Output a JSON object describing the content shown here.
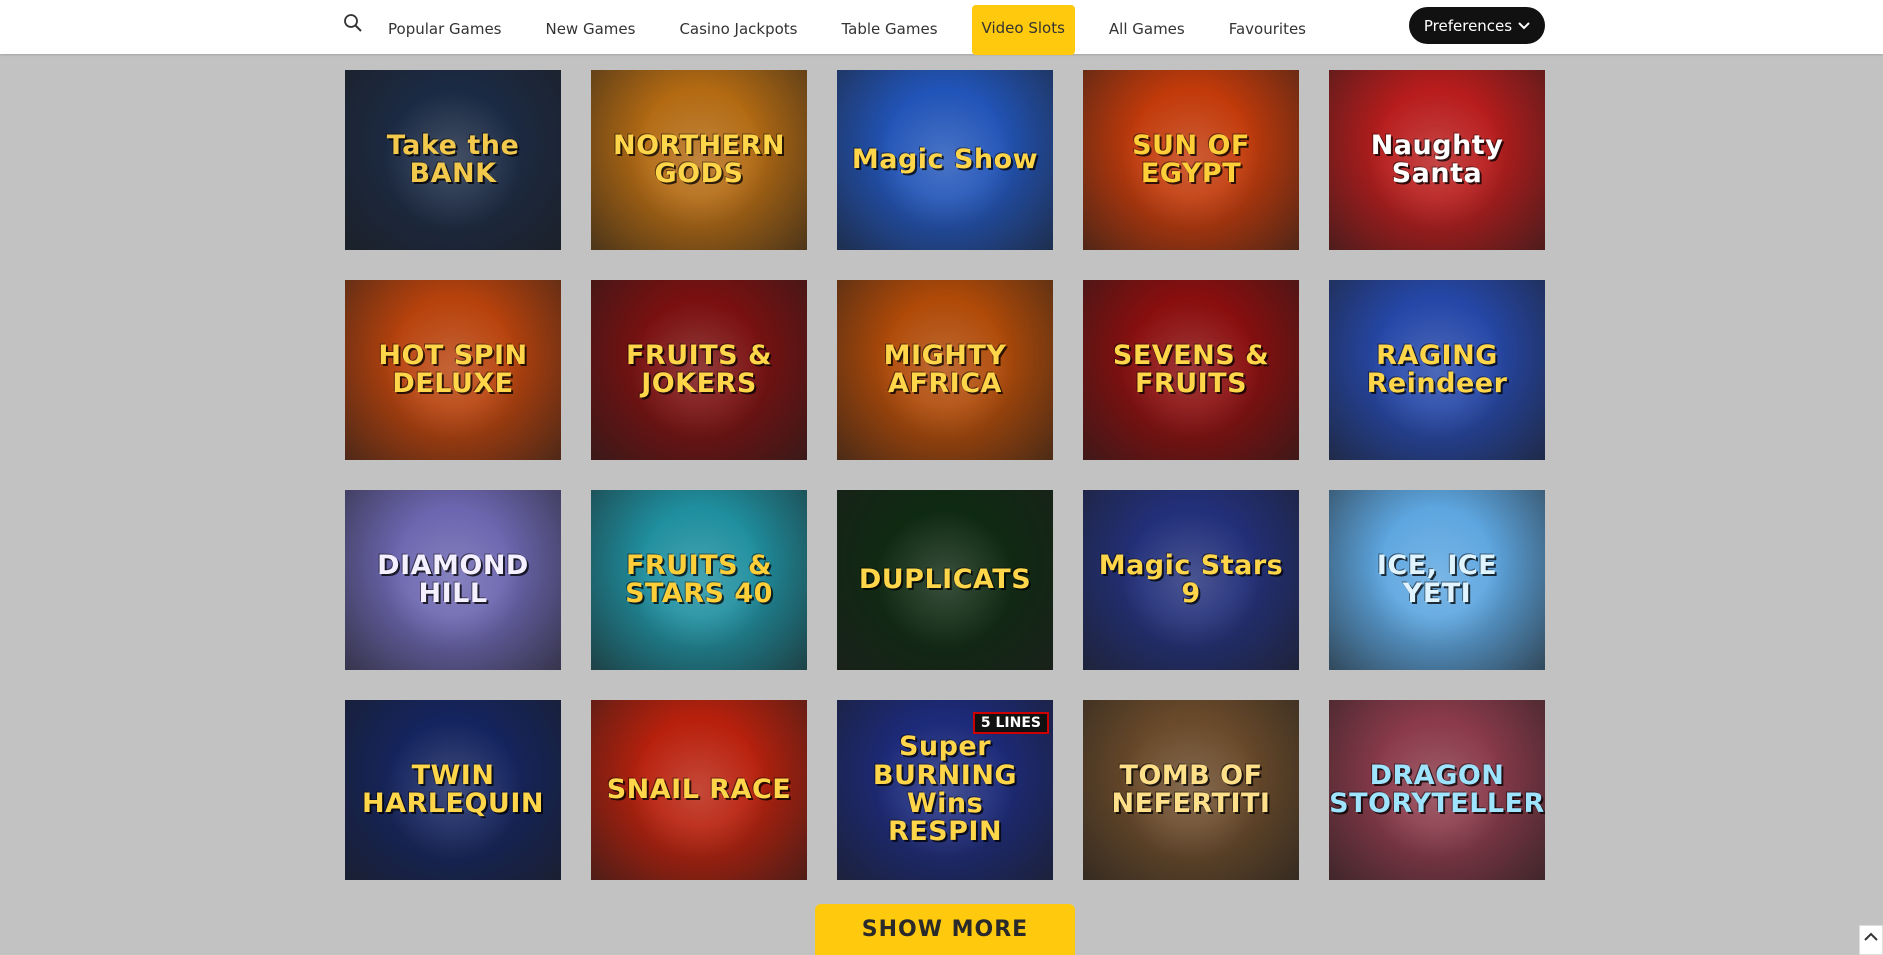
{
  "nav": {
    "tabs": [
      {
        "label": "Popular Games"
      },
      {
        "label": "New Games"
      },
      {
        "label": "Casino Jackpots"
      },
      {
        "label": "Table Games"
      },
      {
        "label": "Video Slots"
      },
      {
        "label": "All Games"
      },
      {
        "label": "Favourites"
      }
    ],
    "active": "Video Slots",
    "search_icon": "search-icon"
  },
  "preferences": {
    "label": "Preferences",
    "icon": "chevron-down-icon"
  },
  "games": [
    {
      "title": "Take the BANK",
      "bg": "#1b2a44",
      "fg": "#f2c94c"
    },
    {
      "title": "NORTHERN GODS",
      "bg": "#b36a12",
      "fg": "#ffd54a"
    },
    {
      "title": "Magic Show",
      "bg": "#2154b8",
      "fg": "#ffd54a"
    },
    {
      "title": "SUN OF EGYPT",
      "bg": "#c23a0a",
      "fg": "#ffcf3a"
    },
    {
      "title": "Naughty Santa",
      "bg": "#b81c1c",
      "fg": "#ffffff"
    },
    {
      "title": "HOT SPIN DELUXE",
      "bg": "#b8420c",
      "fg": "#ffd54a"
    },
    {
      "title": "FRUITS & JOKERS",
      "bg": "#7a1010",
      "fg": "#ffd54a"
    },
    {
      "title": "MIGHTY AFRICA",
      "bg": "#b04a08",
      "fg": "#ffd54a"
    },
    {
      "title": "SEVENS & FRUITS",
      "bg": "#8a0e0e",
      "fg": "#ffd54a"
    },
    {
      "title": "RAGING Reindeer",
      "bg": "#2547a8",
      "fg": "#ffd54a"
    },
    {
      "title": "DIAMOND HILL",
      "bg": "#6c66b0",
      "fg": "#f4f0ff"
    },
    {
      "title": "FRUITS & STARS 40",
      "bg": "#1f8f9f",
      "fg": "#ffcf3a"
    },
    {
      "title": "DUPLICATS",
      "bg": "#0f2a12",
      "fg": "#ffd54a"
    },
    {
      "title": "Magic Stars 9",
      "bg": "#22307a",
      "fg": "#ffd54a"
    },
    {
      "title": "ICE, ICE YETI",
      "bg": "#5da6e0",
      "fg": "#dff4ff"
    },
    {
      "title": "TWIN HARLEQUIN",
      "bg": "#14245e",
      "fg": "#ffd54a"
    },
    {
      "title": "SNAIL RACE",
      "bg": "#b8200c",
      "fg": "#ffd54a"
    },
    {
      "title": "Super BURNING Wins RESPIN",
      "bg": "#1c2a7a",
      "fg": "#ffd54a",
      "badge": "5 LINES"
    },
    {
      "title": "TOMB OF NEFERTITI",
      "bg": "#6a4a2a",
      "fg": "#ffe08a"
    },
    {
      "title": "DRAGON STORYTELLER",
      "bg": "#8a3a4a",
      "fg": "#9fe4ff"
    }
  ],
  "show_more": {
    "label": "SHOW MORE"
  },
  "scroll_top": {
    "icon": "chevron-up-icon"
  }
}
